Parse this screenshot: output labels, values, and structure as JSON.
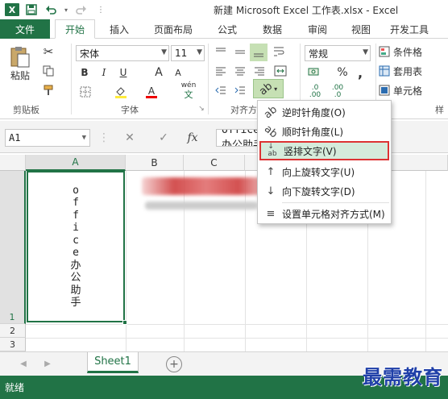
{
  "window": {
    "title": "新建 Microsoft Excel 工作表.xlsx - Excel",
    "logo": "X"
  },
  "qat": {
    "save_icon": "save-icon",
    "undo_icon": "undo-icon",
    "redo_icon": "redo-icon"
  },
  "tabs": [
    {
      "label": "文件"
    },
    {
      "label": "开始"
    },
    {
      "label": "插入"
    },
    {
      "label": "页面布局"
    },
    {
      "label": "公式"
    },
    {
      "label": "数据"
    },
    {
      "label": "审阅"
    },
    {
      "label": "视图"
    },
    {
      "label": "开发工具"
    }
  ],
  "ribbon": {
    "paste_label": "粘贴",
    "font_name": "宋体",
    "font_size": "11",
    "bold": "B",
    "italic": "I",
    "underline": "U",
    "grow": "A",
    "shrink": "A",
    "font_color": "A",
    "wen": "wén",
    "number_format": "常规",
    "percent": "%",
    "comma": ",",
    "inc_decimal": ".00",
    "dec_decimal": ".0",
    "styles": {
      "cond_format": "条件格",
      "table_format": "套用表",
      "cell_style": "单元格"
    },
    "groups": {
      "clipboard": "剪贴板",
      "font": "字体",
      "alignment": "对齐方",
      "styles": "样"
    }
  },
  "formula_bar": {
    "name_box": "A1",
    "fx": "fx",
    "value": "office办公助手"
  },
  "grid": {
    "columns": [
      "A",
      "B",
      "C"
    ],
    "rows": [
      "1",
      "2",
      "3"
    ],
    "cell_a1_chars": [
      "o",
      "f",
      "f",
      "i",
      "c",
      "e",
      "办",
      "公",
      "助",
      "手"
    ]
  },
  "menu": {
    "items": [
      {
        "label": "逆时针角度(O)"
      },
      {
        "label": "顺时针角度(L)"
      },
      {
        "label": "竖排文字(V)"
      },
      {
        "label": "向上旋转文字(U)"
      },
      {
        "label": "向下旋转文字(D)"
      },
      {
        "label": "设置单元格对齐方式(M)"
      }
    ]
  },
  "sheets": [
    {
      "label": "Sheet1"
    }
  ],
  "status": {
    "text": "就绪"
  },
  "watermark": "最需教育",
  "colors": {
    "accent": "#217346",
    "highlight_border": "#d33",
    "menu_hover": "#d5ebdb"
  }
}
